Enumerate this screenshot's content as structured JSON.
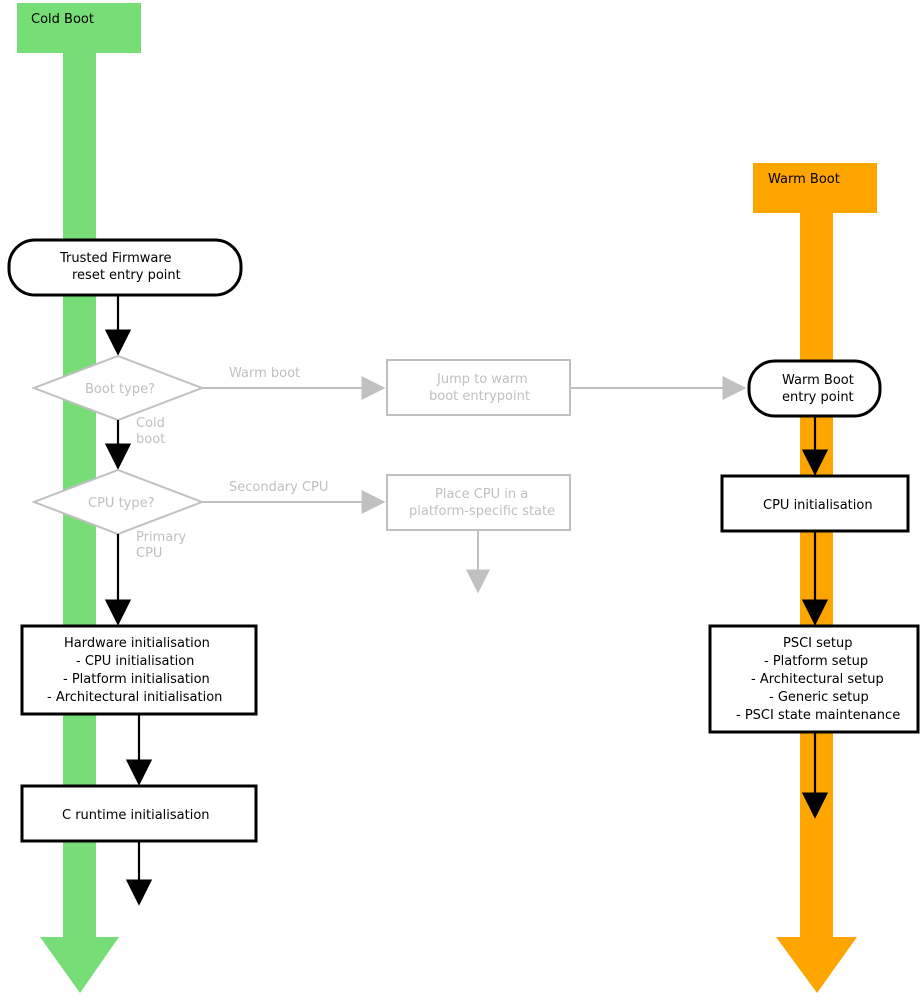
{
  "diagram": {
    "coldBoot": {
      "header": "Cold Boot",
      "trustedFirmware1": "Trusted Firmware",
      "trustedFirmware2": "reset entry point",
      "bootTypeQuestion": "Boot type?",
      "warmBootLabel": "Warm boot",
      "coldBootLabel1": "Cold",
      "coldBootLabel2": "boot",
      "cpuTypeQuestion": "CPU type?",
      "secondaryCpuLabel": "Secondary CPU",
      "primaryCpuLabel1": "Primary",
      "primaryCpuLabel2": "CPU",
      "jumpWarm1": "Jump to warm",
      "jumpWarm2": "boot entrypoint",
      "placeCpu1": "Place CPU in a",
      "placeCpu2": "platform-specific state",
      "hwInit1": "Hardware initialisation",
      "hwInit2": "- CPU initialisation",
      "hwInit3": "- Platform initialisation",
      "hwInit4": "- Architectural initialisation",
      "cRuntime": "C runtime initialisation"
    },
    "warmBoot": {
      "header": "Warm Boot",
      "entry1": "Warm Boot",
      "entry2": "entry point",
      "cpuInit": "CPU initialisation",
      "psci1": "PSCI setup",
      "psci2": "- Platform setup",
      "psci3": "- Architectural setup",
      "psci4": "- Generic setup",
      "psci5": "- PSCI state maintenance"
    }
  },
  "colors": {
    "green": "#77dd77",
    "orange": "#ffa500",
    "grey": "#c0c0c0",
    "black": "#000000"
  }
}
